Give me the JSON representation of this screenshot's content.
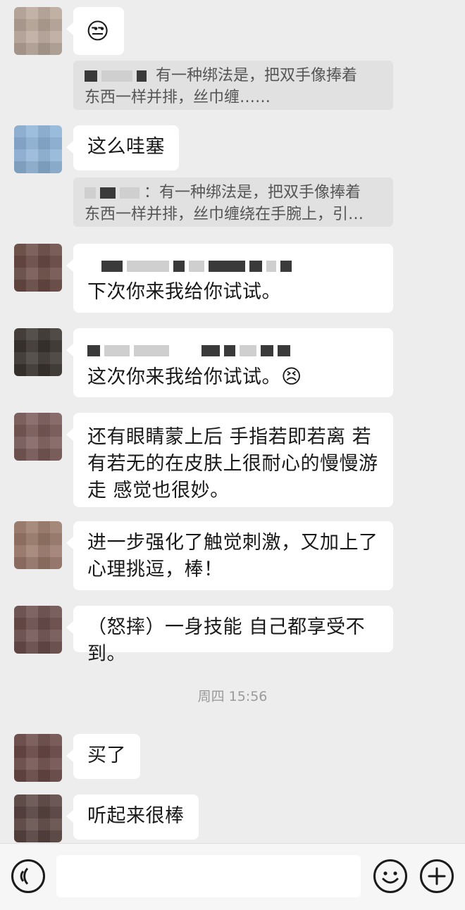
{
  "messages": [
    {
      "id": "m1",
      "emoji": "😒",
      "quote": {
        "line1": "有一种绑法是，把双手像捧着",
        "line2": "东西一样并排，丝巾缠……"
      }
    },
    {
      "id": "m2",
      "text": "这么哇塞",
      "quote": {
        "line1": "有一种绑法是，把双手像捧着",
        "line2": "东西一样并排，丝巾缠绕在手腕上，引…"
      }
    },
    {
      "id": "m3",
      "text": "下次你来我给你试试。"
    },
    {
      "id": "m4",
      "text": "这次你来我给你试试。",
      "emoji": "😣"
    },
    {
      "id": "m5",
      "lines": [
        "还有眼睛蒙上后  手指若即若离 若",
        "有若无的在皮肤上很耐心的慢慢游",
        "走   感觉也很妙。"
      ]
    },
    {
      "id": "m6",
      "lines": [
        "进一步强化了触觉刺激，又加上了",
        "心理挑逗，棒！"
      ]
    },
    {
      "id": "m7",
      "text": "（怒摔）一身技能 自己都享受不到。"
    },
    {
      "id": "m8",
      "text": "买了"
    },
    {
      "id": "m9",
      "text": "听起来很棒"
    }
  ],
  "timestamp": "周四 15:56",
  "input": {
    "placeholder": ""
  },
  "icons": {
    "voice": "voice-icon",
    "emoji": "emoji-icon",
    "plus": "plus-icon"
  }
}
